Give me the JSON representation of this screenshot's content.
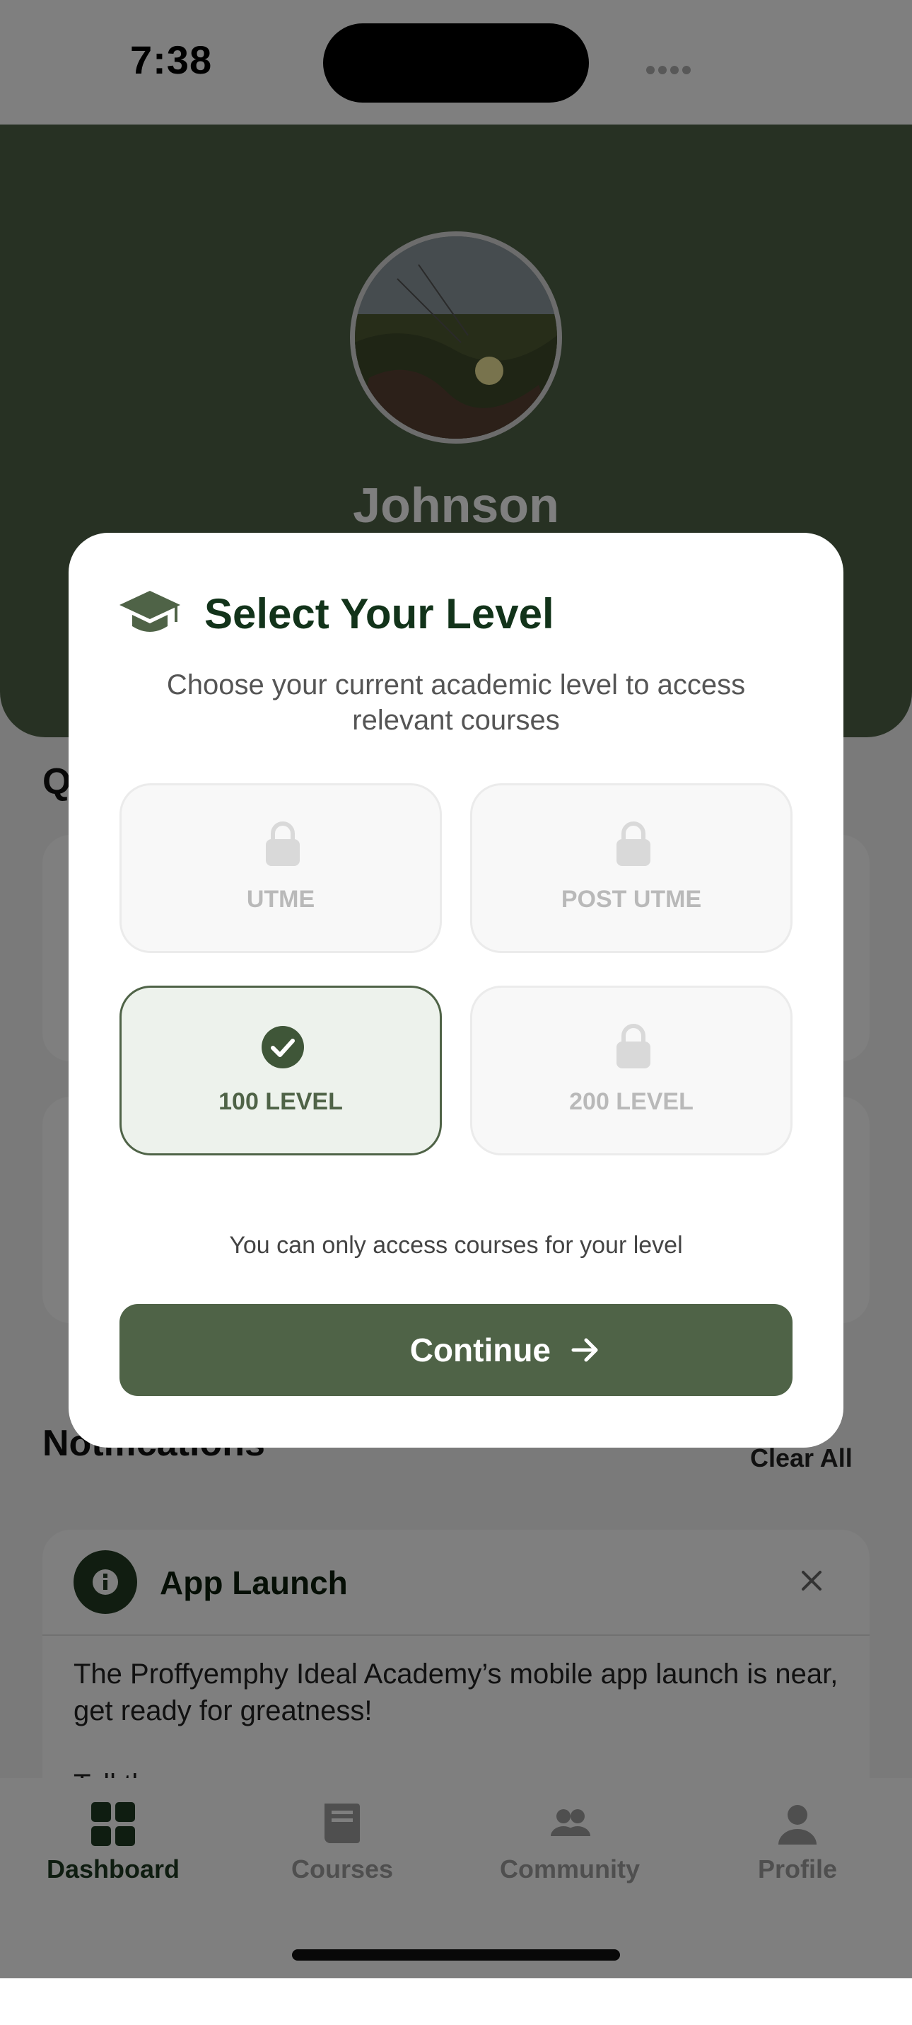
{
  "status_bar": {
    "time": "7:38"
  },
  "profile": {
    "name": "Johnson"
  },
  "sections": {
    "quick_title": "Q",
    "notifications_title": "Notifications",
    "clear_all": "Clear All"
  },
  "notification": {
    "title": "App Launch",
    "body": "The Proffyemphy Ideal Academy’s mobile app launch is near, get ready for greatness!",
    "body_cut": "Tell th"
  },
  "modal": {
    "title": "Select Your Level",
    "subtitle": "Choose your current academic level to access relevant courses",
    "options": [
      {
        "label": "UTME",
        "state": "locked",
        "icon": "lock-icon"
      },
      {
        "label": "POST UTME",
        "state": "locked",
        "icon": "lock-icon"
      },
      {
        "label": "100 LEVEL",
        "state": "selected",
        "icon": "check-circle-icon"
      },
      {
        "label": "200 LEVEL",
        "state": "locked",
        "icon": "lock-icon"
      }
    ],
    "note": "You can only access courses for your level",
    "continue_label": "Continue"
  },
  "tabs": [
    {
      "label": "Dashboard",
      "icon": "grid-icon",
      "active": true
    },
    {
      "label": "Courses",
      "icon": "book-icon",
      "active": false
    },
    {
      "label": "Community",
      "icon": "people-icon",
      "active": false
    },
    {
      "label": "Profile",
      "icon": "person-icon",
      "active": false
    }
  ],
  "colors": {
    "primary": "#4f6347",
    "dark_green": "#12331a",
    "scrim": "rgba(0,0,0,0.5)"
  }
}
